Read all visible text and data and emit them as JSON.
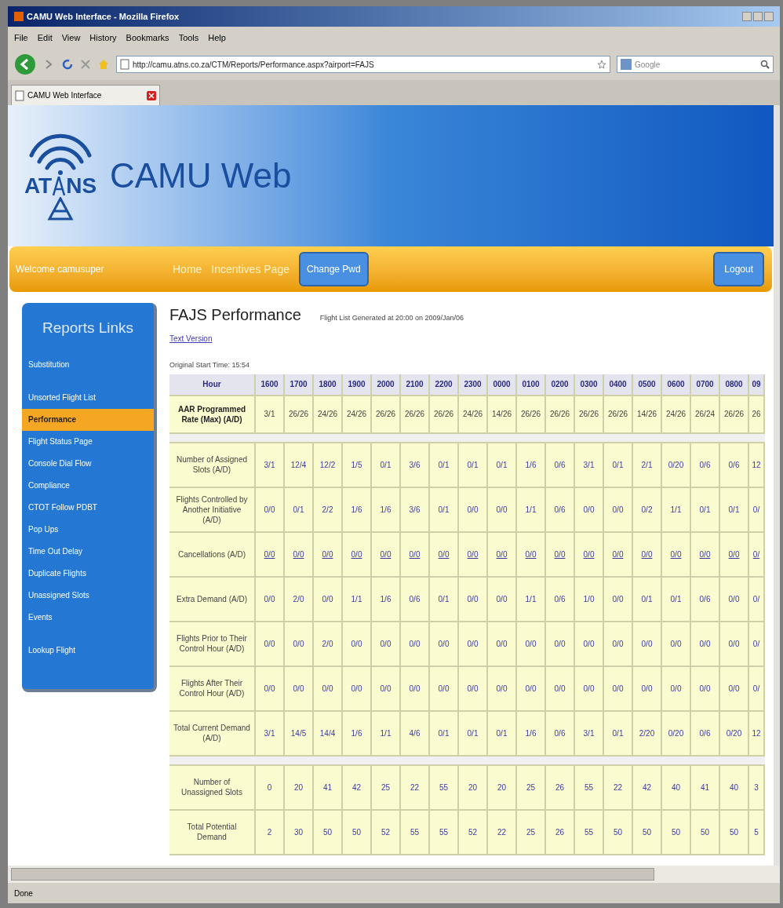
{
  "browser": {
    "title": "CAMU Web Interface - Mozilla Firefox",
    "menu": [
      "File",
      "Edit",
      "View",
      "History",
      "Bookmarks",
      "Tools",
      "Help"
    ],
    "url": "http://camu.atns.co.za/CTM/Reports/Performance.aspx?airport=FAJS",
    "search_placeholder": "Google",
    "tab": "CAMU Web Interface",
    "status": "Done"
  },
  "banner": {
    "logo_left": "AT",
    "logo_right": "NS",
    "title": "CAMU Web"
  },
  "nav": {
    "welcome": "Welcome camusuper",
    "items": [
      {
        "label": "Home",
        "kind": "link"
      },
      {
        "label": "Incentives Page",
        "kind": "link"
      },
      {
        "label": "Change Pwd",
        "kind": "button"
      }
    ],
    "logout": "Logout"
  },
  "sidebar": {
    "title": "Reports Links",
    "items": [
      {
        "label": "Substitution",
        "selected": false
      },
      {
        "label": "Unsorted Flight List",
        "selected": false
      },
      {
        "label": "Performance",
        "selected": true
      },
      {
        "label": "Flight Status Page",
        "selected": false
      },
      {
        "label": "Console Dial Flow",
        "selected": false
      },
      {
        "label": "Compliance",
        "selected": false
      },
      {
        "label": "CTOT Follow PDBT",
        "selected": false
      },
      {
        "label": "Pop Ups",
        "selected": false
      },
      {
        "label": "Time Out Delay",
        "selected": false
      },
      {
        "label": "Duplicate Flights",
        "selected": false
      },
      {
        "label": "Unassigned Slots",
        "selected": false
      },
      {
        "label": "Events",
        "selected": false
      },
      {
        "label": "Lookup Flight",
        "selected": false
      }
    ]
  },
  "page": {
    "title": "FAJS Performance",
    "generated": "Flight List Generated at 20:00 on 2009/Jan/06",
    "text_version_link": "Text Version",
    "start_time": "Original Start Time: 15:54"
  },
  "table": {
    "columns": [
      "Hour",
      "1600",
      "1700",
      "1800",
      "1900",
      "2000",
      "2100",
      "2200",
      "2300",
      "0000",
      "0100",
      "0200",
      "0300",
      "0400",
      "0500",
      "0600",
      "0700",
      "0800",
      "09"
    ],
    "groups": [
      {
        "rows": [
          {
            "kind": "rate",
            "underlined": false,
            "label": "AAR Programmed Rate (Max) (A/D)",
            "values": [
              "3/1",
              "26/26",
              "24/26",
              "24/26",
              "26/26",
              "26/26",
              "26/26",
              "24/26",
              "14/26",
              "26/26",
              "26/26",
              "26/26",
              "26/26",
              "14/26",
              "24/26",
              "26/24",
              "26/26",
              "26"
            ]
          }
        ]
      },
      {
        "rows": [
          {
            "kind": "count",
            "underlined": false,
            "label": "Number of Assigned Slots (A/D)",
            "values": [
              "3/1",
              "12/4",
              "12/2",
              "1/5",
              "0/1",
              "3/6",
              "0/1",
              "0/1",
              "0/1",
              "1/6",
              "0/6",
              "3/1",
              "0/1",
              "2/1",
              "0/20",
              "0/6",
              "0/6",
              "12"
            ]
          },
          {
            "kind": "count",
            "underlined": false,
            "label": "Flights Controlled by Another Initiative (A/D)",
            "values": [
              "0/0",
              "0/1",
              "2/2",
              "1/6",
              "1/6",
              "3/6",
              "0/1",
              "0/0",
              "0/0",
              "1/1",
              "0/6",
              "0/0",
              "0/0",
              "0/2",
              "1/1",
              "0/1",
              "0/1",
              "0/"
            ]
          },
          {
            "kind": "count",
            "underlined": true,
            "label": "Cancellations (A/D)",
            "values": [
              "0/0",
              "0/0",
              "0/0",
              "0/0",
              "0/0",
              "0/0",
              "0/0",
              "0/0",
              "0/0",
              "0/0",
              "0/0",
              "0/0",
              "0/0",
              "0/0",
              "0/0",
              "0/0",
              "0/0",
              "0/"
            ]
          },
          {
            "kind": "count",
            "underlined": false,
            "label": "Extra Demand (A/D)",
            "values": [
              "0/0",
              "2/0",
              "0/0",
              "1/1",
              "1/6",
              "0/6",
              "0/1",
              "0/0",
              "0/0",
              "1/1",
              "0/6",
              "1/0",
              "0/0",
              "0/1",
              "0/1",
              "0/6",
              "0/0",
              "0/"
            ]
          },
          {
            "kind": "count",
            "underlined": false,
            "label": "Flights Prior to Their Control Hour (A/D)",
            "values": [
              "0/0",
              "0/0",
              "2/0",
              "0/0",
              "0/0",
              "0/0",
              "0/0",
              "0/0",
              "0/0",
              "0/0",
              "0/0",
              "0/0",
              "0/0",
              "0/0",
              "0/0",
              "0/0",
              "0/0",
              "0/"
            ]
          },
          {
            "kind": "count",
            "underlined": false,
            "label": "Flights After Their Control Hour (A/D)",
            "values": [
              "0/0",
              "0/0",
              "0/0",
              "0/0",
              "0/0",
              "0/0",
              "0/0",
              "0/0",
              "0/0",
              "0/0",
              "0/0",
              "0/0",
              "0/0",
              "0/0",
              "0/0",
              "0/0",
              "0/0",
              "0/"
            ]
          },
          {
            "kind": "count",
            "underlined": false,
            "label": "Total Current Demand (A/D)",
            "values": [
              "3/1",
              "14/5",
              "14/4",
              "1/6",
              "1/1",
              "4/6",
              "0/1",
              "0/1",
              "0/1",
              "1/6",
              "0/6",
              "3/1",
              "0/1",
              "2/20",
              "0/20",
              "0/6",
              "0/20",
              "12"
            ]
          }
        ]
      },
      {
        "rows": [
          {
            "kind": "total",
            "underlined": false,
            "label": "Number of Unassigned Slots",
            "values": [
              "0",
              "20",
              "41",
              "42",
              "25",
              "22",
              "55",
              "20",
              "20",
              "25",
              "26",
              "55",
              "22",
              "42",
              "40",
              "41",
              "40",
              "3"
            ]
          },
          {
            "kind": "total",
            "underlined": false,
            "label": "Total Potential Demand",
            "values": [
              "2",
              "30",
              "50",
              "50",
              "52",
              "55",
              "55",
              "52",
              "22",
              "25",
              "26",
              "55",
              "50",
              "50",
              "50",
              "50",
              "50",
              "5"
            ]
          }
        ]
      }
    ]
  }
}
